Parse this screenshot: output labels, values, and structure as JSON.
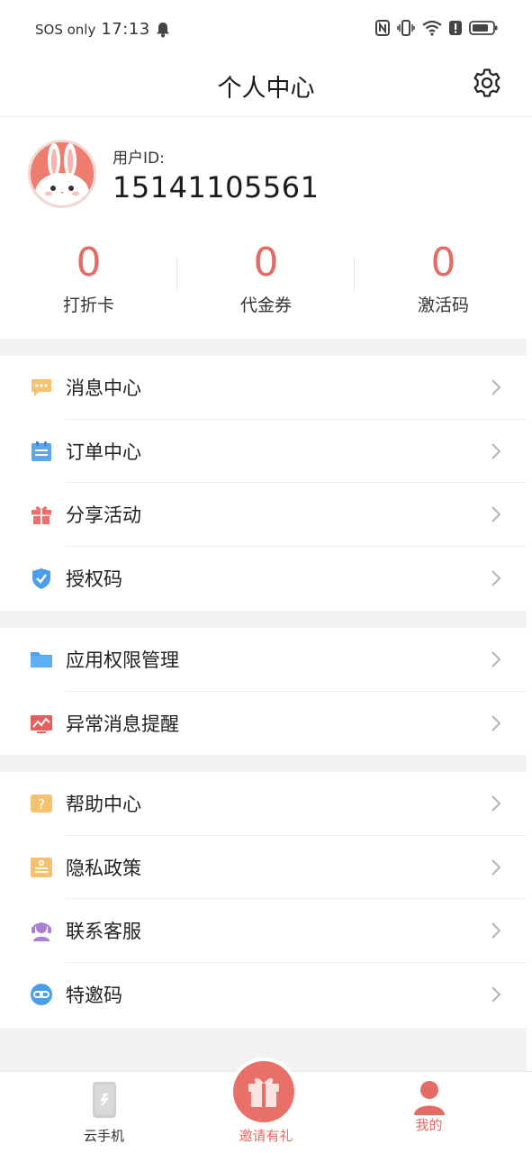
{
  "status_bar": {
    "carrier": "SOS only",
    "time": "17:13"
  },
  "header": {
    "title": "个人中心"
  },
  "profile": {
    "uid_label": "用户ID:",
    "uid_value": "15141105561"
  },
  "stats": [
    {
      "value": "0",
      "label": "打折卡"
    },
    {
      "value": "0",
      "label": "代金券"
    },
    {
      "value": "0",
      "label": "激活码"
    }
  ],
  "groups": [
    [
      {
        "label": "消息中心",
        "icon": "message-icon",
        "color": "#f5c271"
      },
      {
        "label": "订单中心",
        "icon": "order-icon",
        "color": "#5aa6ef"
      },
      {
        "label": "分享活动",
        "icon": "gift-icon",
        "color": "#ec6f6c"
      },
      {
        "label": "授权码",
        "icon": "shield-icon",
        "color": "#4d9ee9"
      }
    ],
    [
      {
        "label": "应用权限管理",
        "icon": "folder-icon",
        "color": "#4aa3f1"
      },
      {
        "label": "异常消息提醒",
        "icon": "chart-alert-icon",
        "color": "#e5605c"
      }
    ],
    [
      {
        "label": "帮助中心",
        "icon": "question-icon",
        "color": "#f5c271"
      },
      {
        "label": "隐私政策",
        "icon": "policy-icon",
        "color": "#f5c271"
      },
      {
        "label": "联系客服",
        "icon": "headset-icon",
        "color": "#a97fd6"
      },
      {
        "label": "特邀码",
        "icon": "link-icon",
        "color": "#4d9ee9"
      }
    ]
  ],
  "tabbar": {
    "tabs": [
      {
        "label": "云手机",
        "color": "#333333"
      },
      {
        "label": "邀请有礼",
        "color": "#e36c65"
      },
      {
        "label": "我的",
        "color": "#e36c65"
      }
    ]
  },
  "colors": {
    "accent": "#e36c65",
    "divider": "#f2f2f2"
  }
}
